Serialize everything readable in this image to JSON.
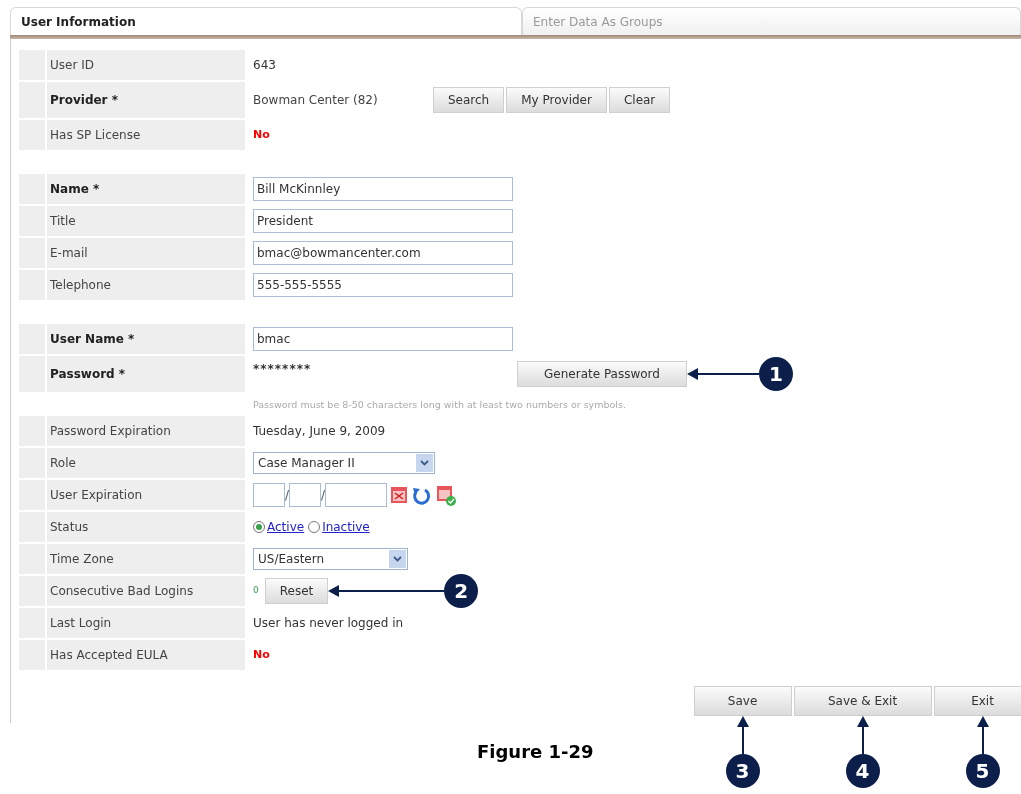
{
  "tabs": [
    {
      "label": "User Information",
      "selected": true
    },
    {
      "label": "Enter Data As Groups",
      "selected": false
    }
  ],
  "sections": [
    {
      "rows": [
        {
          "kind": "text",
          "label": "User ID",
          "required": false,
          "value": "643"
        },
        {
          "kind": "provider",
          "label": "Provider *",
          "required": true,
          "value": "Bowman Center (82)",
          "buttons": [
            "Search",
            "My Provider",
            "Clear"
          ]
        },
        {
          "kind": "alert",
          "label": "Has SP License",
          "required": false,
          "value": "No"
        }
      ]
    },
    {
      "rows": [
        {
          "kind": "input",
          "label": "Name *",
          "required": true,
          "value": "Bill McKinnley"
        },
        {
          "kind": "input",
          "label": "Title",
          "required": false,
          "value": "President"
        },
        {
          "kind": "input",
          "label": "E-mail",
          "required": false,
          "value": "bmac@bowmancenter.com"
        },
        {
          "kind": "input",
          "label": "Telephone",
          "required": false,
          "value": "555-555-5555"
        }
      ]
    },
    {
      "rows": [
        {
          "kind": "input",
          "label": "User Name *",
          "required": true,
          "value": "bmac"
        },
        {
          "kind": "password",
          "label": "Password *",
          "required": true,
          "value": "********",
          "button": "Generate Password",
          "callout": "1"
        },
        {
          "kind": "hint",
          "value": "Password must be 8-50 characters long with at least two numbers or symbols."
        },
        {
          "kind": "text",
          "label": "Password Expiration",
          "required": false,
          "value": "Tuesday, June 9, 2009"
        },
        {
          "kind": "select",
          "label": "Role",
          "required": false,
          "value": "Case Manager II"
        },
        {
          "kind": "date",
          "label": "User Expiration",
          "required": false,
          "separators": [
            "/",
            "/"
          ]
        },
        {
          "kind": "radio",
          "label": "Status",
          "required": false,
          "options": [
            {
              "label": "Active",
              "selected": true
            },
            {
              "label": "Inactive",
              "selected": false
            }
          ]
        },
        {
          "kind": "select",
          "label": "Time Zone",
          "required": false,
          "value": "US/Eastern"
        },
        {
          "kind": "counter",
          "label": "Consecutive Bad Logins",
          "required": false,
          "value": "0",
          "button": "Reset",
          "callout": "2"
        },
        {
          "kind": "text",
          "label": "Last Login",
          "required": false,
          "value": "User has never logged in"
        },
        {
          "kind": "alert",
          "label": "Has Accepted EULA",
          "required": false,
          "value": "No"
        }
      ]
    }
  ],
  "actions": [
    {
      "label": "Save",
      "callout": "3"
    },
    {
      "label": "Save & Exit",
      "callout": "4"
    },
    {
      "label": "Exit",
      "callout": "5"
    }
  ],
  "caption": "Figure 1-29"
}
